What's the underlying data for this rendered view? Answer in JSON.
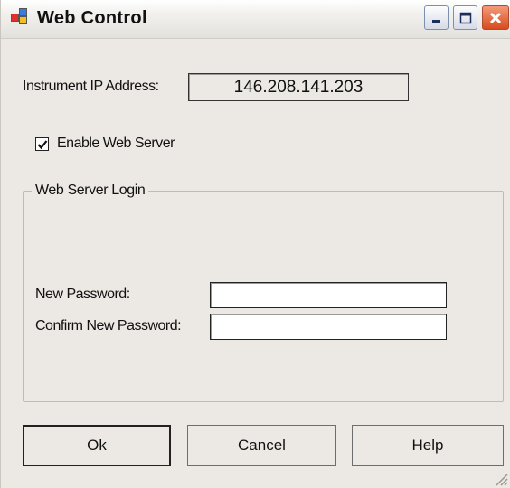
{
  "window": {
    "title": "Web Control"
  },
  "titlebar_buttons": {
    "minimize_icon": "minimize-icon",
    "maximize_icon": "maximize-icon",
    "close_icon": "close-icon"
  },
  "network": {
    "ip_label": "Instrument IP Address:",
    "ip_value": "146.208.141.203"
  },
  "web_server": {
    "enable_label": "Enable Web Server",
    "enabled": true
  },
  "login_group": {
    "title": "Web Server Login",
    "new_password_label": "New Password:",
    "new_password_value": "",
    "confirm_password_label": "Confirm New Password:",
    "confirm_password_value": ""
  },
  "buttons": {
    "ok": "Ok",
    "cancel": "Cancel",
    "help": "Help"
  },
  "colors": {
    "window_bg": "#ece9e4",
    "close_button": "#d84b1e"
  }
}
